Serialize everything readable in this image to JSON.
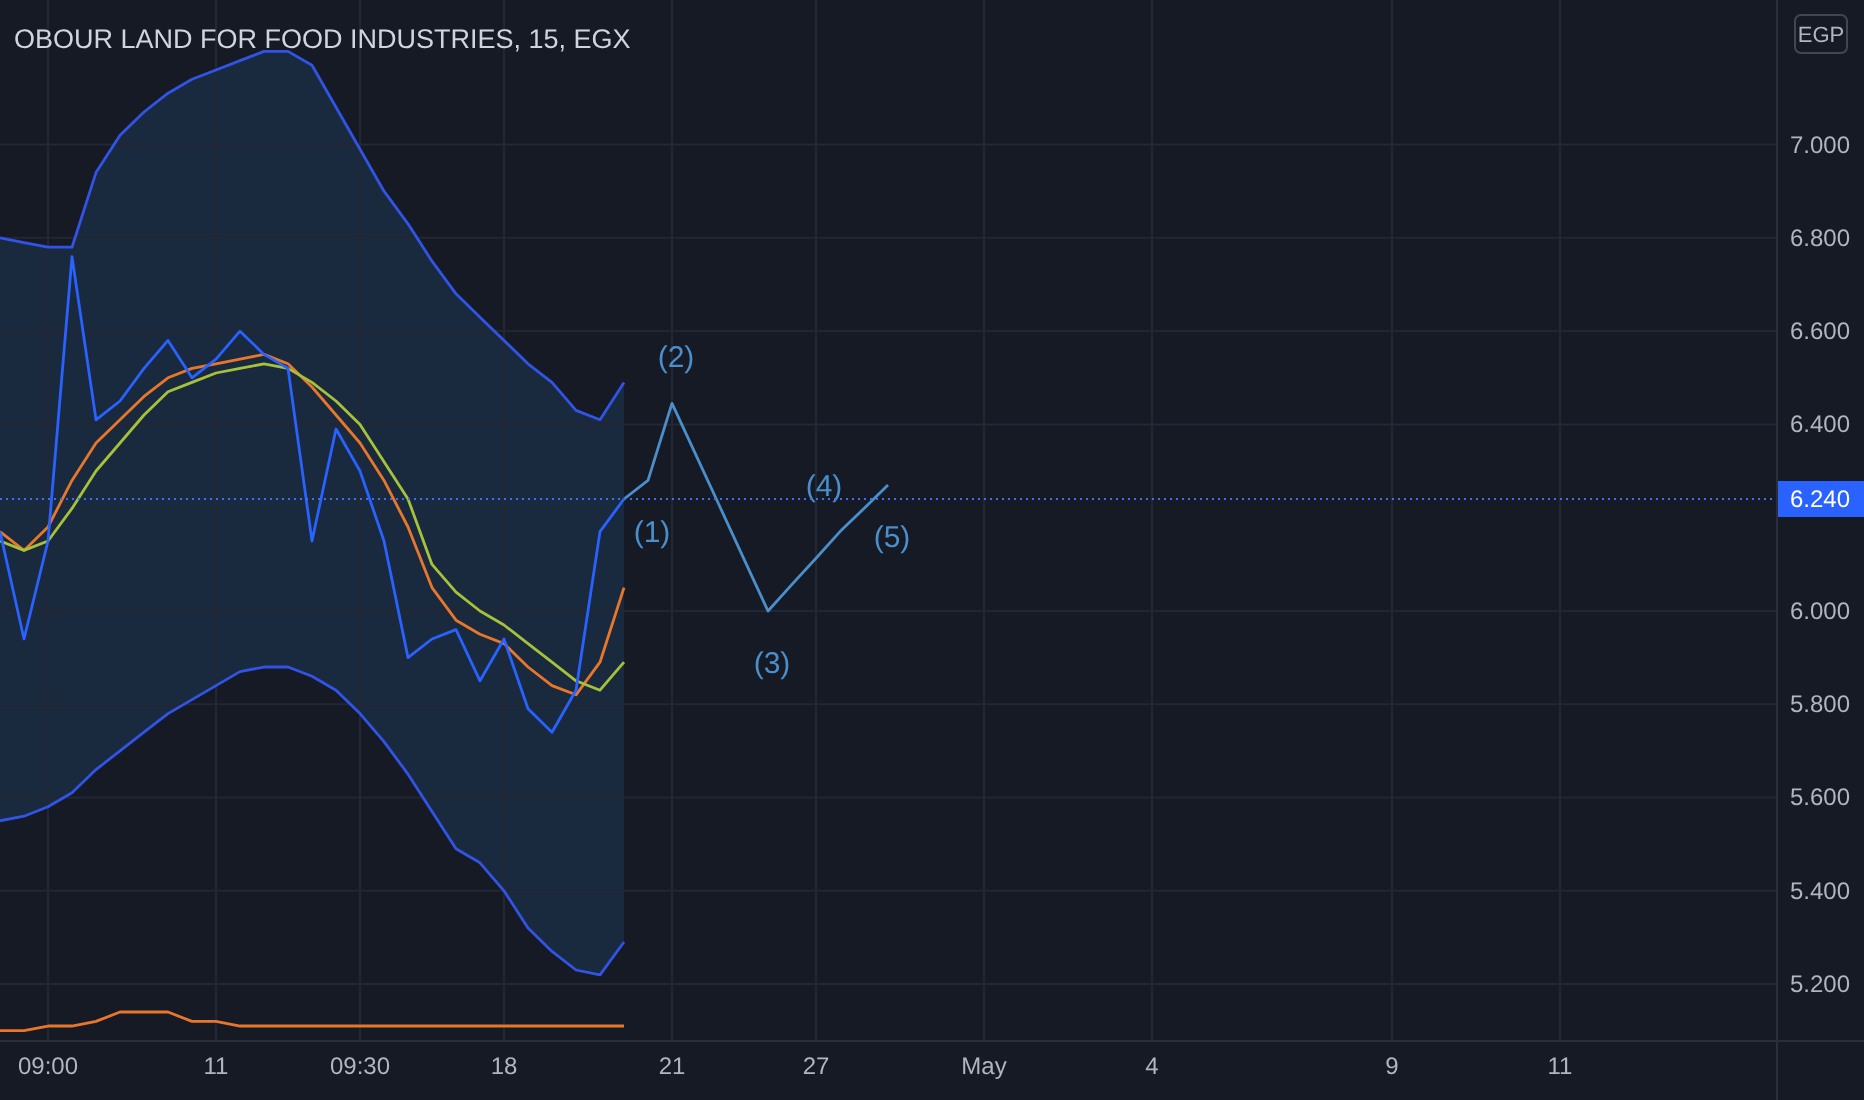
{
  "chart": {
    "title": "OBOUR LAND FOR FOOD INDUSTRIES, 15, EGX",
    "currency": "EGP",
    "last_price": "6.240",
    "chart_data": {
      "type": "line",
      "grid": true,
      "categories": [
        null,
        null,
        "09:00",
        null,
        null,
        null,
        null,
        null,
        null,
        "11",
        null,
        null,
        null,
        null,
        null,
        "09:30",
        null,
        null,
        null,
        null,
        null,
        "18",
        null,
        null,
        null,
        null,
        null,
        null,
        "21",
        null,
        null,
        null,
        null,
        null,
        "27",
        null,
        null,
        null,
        null,
        null,
        null,
        "May",
        null,
        null,
        null,
        null,
        null,
        null,
        "4",
        null,
        null,
        null,
        null,
        null,
        null,
        null,
        null,
        null,
        "9",
        null,
        null,
        null,
        null,
        null,
        null,
        "11",
        null,
        null,
        null,
        null,
        null,
        null,
        null,
        null
      ],
      "ylim": [
        5.08,
        7.31
      ],
      "yticks": [
        {
          "value": 5.2,
          "label": "5.200"
        },
        {
          "value": 5.4,
          "label": "5.400"
        },
        {
          "value": 5.6,
          "label": "5.600"
        },
        {
          "value": 5.8,
          "label": "5.800"
        },
        {
          "value": 6.0,
          "label": "6.000"
        },
        {
          "value": 6.4,
          "label": "6.400"
        },
        {
          "value": 6.6,
          "label": "6.600"
        },
        {
          "value": 6.8,
          "label": "6.800"
        },
        {
          "value": 7.0,
          "label": "7.000"
        }
      ],
      "series": [
        {
          "color": "#3154e6",
          "values": [
            6.8,
            6.79,
            6.78,
            6.78,
            6.94,
            7.02,
            7.07,
            7.11,
            7.14,
            7.16,
            7.18,
            7.2,
            7.2,
            7.17,
            7.08,
            6.99,
            6.9,
            6.83,
            6.75,
            6.68,
            6.63,
            6.58,
            6.53,
            6.49,
            6.43,
            6.41,
            6.49,
            null,
            null,
            null,
            null,
            null,
            null,
            null,
            null,
            null,
            null,
            null,
            null,
            null,
            null,
            null,
            null,
            null,
            null,
            null,
            null,
            null,
            null,
            null,
            null,
            null,
            null,
            null,
            null,
            null,
            null,
            null,
            null,
            null,
            null,
            null,
            null,
            null,
            null,
            null,
            null,
            null,
            null,
            null,
            null,
            null,
            null,
            null
          ]
        },
        {
          "color": "#3154e6",
          "values": [
            5.55,
            5.56,
            5.58,
            5.61,
            5.66,
            5.7,
            5.74,
            5.78,
            5.81,
            5.84,
            5.87,
            5.88,
            5.88,
            5.86,
            5.83,
            5.78,
            5.72,
            5.65,
            5.57,
            5.49,
            5.46,
            5.4,
            5.32,
            5.27,
            5.23,
            5.22,
            5.29,
            null,
            null,
            null,
            null,
            null,
            null,
            null,
            null,
            null,
            null,
            null,
            null,
            null,
            null,
            null,
            null,
            null,
            null,
            null,
            null,
            null,
            null,
            null,
            null,
            null,
            null,
            null,
            null,
            null,
            null,
            null,
            null,
            null,
            null,
            null,
            null,
            null,
            null,
            null,
            null,
            null,
            null,
            null,
            null,
            null,
            null,
            null
          ]
        },
        {
          "color": "#e8772b",
          "values": [
            6.17,
            6.13,
            6.18,
            6.28,
            6.36,
            6.41,
            6.46,
            6.5,
            6.52,
            6.53,
            6.54,
            6.55,
            6.53,
            6.48,
            6.42,
            6.36,
            6.28,
            6.18,
            6.05,
            5.98,
            5.95,
            5.93,
            5.88,
            5.84,
            5.82,
            5.89,
            6.05,
            null,
            null,
            null,
            null,
            null,
            null,
            null,
            null,
            null,
            null,
            null,
            null,
            null,
            null,
            null,
            null,
            null,
            null,
            null,
            null,
            null,
            null,
            null,
            null,
            null,
            null,
            null,
            null,
            null,
            null,
            null,
            null,
            null,
            null,
            null,
            null,
            null,
            null,
            null,
            null,
            null,
            null,
            null,
            null,
            null,
            null,
            null
          ]
        },
        {
          "color": "#a6c23a",
          "values": [
            6.15,
            6.13,
            6.15,
            6.22,
            6.3,
            6.36,
            6.42,
            6.47,
            6.49,
            6.51,
            6.52,
            6.53,
            6.52,
            6.49,
            6.45,
            6.4,
            6.32,
            6.24,
            6.1,
            6.04,
            6.0,
            5.97,
            5.93,
            5.89,
            5.85,
            5.83,
            5.89,
            null,
            null,
            null,
            null,
            null,
            null,
            null,
            null,
            null,
            null,
            null,
            null,
            null,
            null,
            null,
            null,
            null,
            null,
            null,
            null,
            null,
            null,
            null,
            null,
            null,
            null,
            null,
            null,
            null,
            null,
            null,
            null,
            null,
            null,
            null,
            null,
            null,
            null,
            null,
            null,
            null,
            null,
            null,
            null,
            null,
            null,
            null
          ]
        },
        {
          "color": "#2962ff",
          "values": [
            6.17,
            5.94,
            6.15,
            6.76,
            6.41,
            6.45,
            6.52,
            6.58,
            6.5,
            6.54,
            6.6,
            6.55,
            6.52,
            6.15,
            6.39,
            6.3,
            6.15,
            5.9,
            5.94,
            5.96,
            5.85,
            5.94,
            5.79,
            5.74,
            5.83,
            6.17,
            6.24,
            null,
            null,
            null,
            null,
            null,
            null,
            null,
            null,
            null,
            null,
            null,
            null,
            null,
            null,
            null,
            null,
            null,
            null,
            null,
            null,
            null,
            null,
            null,
            null,
            null,
            null,
            null,
            null,
            null,
            null,
            null,
            null,
            null,
            null,
            null,
            null,
            null,
            null,
            null,
            null,
            null,
            null,
            null,
            null,
            null,
            null,
            null
          ]
        },
        {
          "color": "#4a8fcc",
          "values": [
            null,
            null,
            null,
            null,
            null,
            null,
            null,
            null,
            null,
            null,
            null,
            null,
            null,
            null,
            null,
            null,
            null,
            null,
            null,
            null,
            null,
            null,
            null,
            null,
            null,
            null,
            6.24,
            6.28,
            6.445,
            6.334,
            6.223,
            6.111,
            6.0,
            6.057,
            6.113,
            6.17,
            6.22,
            6.27,
            null,
            null,
            null,
            null,
            null,
            null,
            null,
            null,
            null,
            null,
            null,
            null,
            null,
            null,
            null,
            null,
            null,
            null,
            null,
            null,
            null,
            null,
            null,
            null,
            null,
            null,
            null,
            null,
            null,
            null,
            null,
            null,
            null,
            null,
            null,
            null
          ]
        },
        {
          "color": "#e8772b",
          "values": [
            5.1,
            5.1,
            5.11,
            5.11,
            5.12,
            5.14,
            5.14,
            5.14,
            5.12,
            5.12,
            5.11,
            5.11,
            5.11,
            5.11,
            5.11,
            5.11,
            5.11,
            5.11,
            5.11,
            5.11,
            5.11,
            5.11,
            5.11,
            5.11,
            5.11,
            5.11,
            5.11,
            null,
            null,
            null,
            null,
            null,
            null,
            null,
            null,
            null,
            null,
            null,
            null,
            null,
            null,
            null,
            null,
            null,
            null,
            null,
            null,
            null,
            null,
            null,
            null,
            null,
            null,
            null,
            null,
            null,
            null,
            null,
            null,
            null,
            null,
            null,
            null,
            null,
            null,
            null,
            null,
            null,
            null,
            null,
            null,
            null,
            null,
            null
          ]
        }
      ],
      "annotations": [
        "(1)",
        "(2)",
        "(3)",
        "(4)",
        "(5)"
      ]
    }
  }
}
